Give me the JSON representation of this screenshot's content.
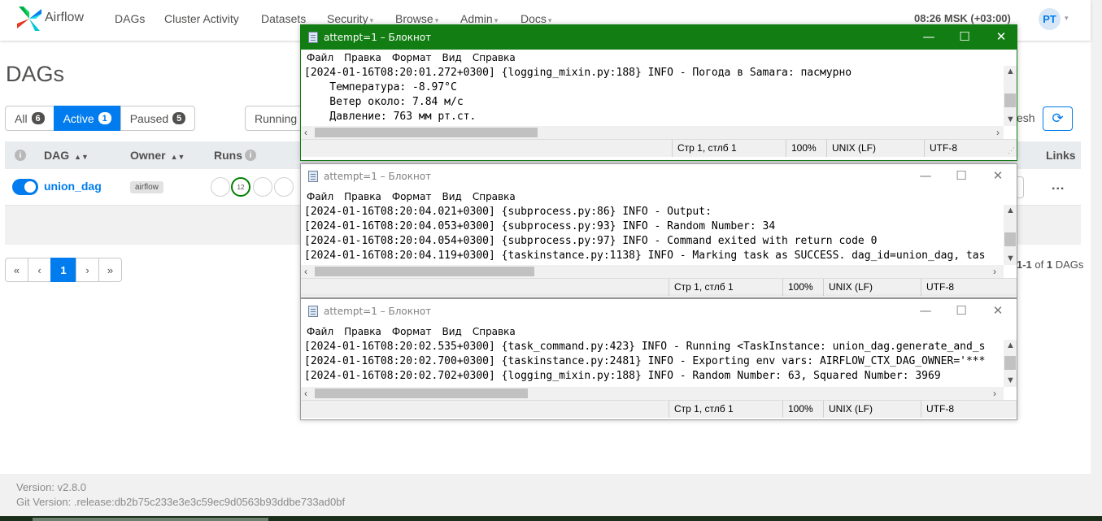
{
  "navbar": {
    "brand": "Airflow",
    "items": [
      {
        "label": "DAGs",
        "dropdown": false
      },
      {
        "label": "Cluster Activity",
        "dropdown": false
      },
      {
        "label": "Datasets",
        "dropdown": false
      },
      {
        "label": "Security",
        "dropdown": true
      },
      {
        "label": "Browse",
        "dropdown": true
      },
      {
        "label": "Admin",
        "dropdown": true
      },
      {
        "label": "Docs",
        "dropdown": true
      }
    ],
    "clock": "08:26 MSK (+03:00)",
    "user_initials": "PT",
    "colors": {
      "accent": "#017cee"
    }
  },
  "page": {
    "title": "DAGs",
    "filters": [
      {
        "label": "All",
        "count": "6",
        "active": false
      },
      {
        "label": "Active",
        "count": "1",
        "active": true
      },
      {
        "label": "Paused",
        "count": "5",
        "active": false
      }
    ],
    "running_label": "Running",
    "refresh_label": "esh",
    "refresh_icon": "refresh-icon",
    "table": {
      "headers": {
        "info": "i",
        "dag": "DAG",
        "owner": "Owner",
        "runs": "Runs",
        "links": "Links"
      },
      "rows": [
        {
          "enabled": true,
          "dag_id": "union_dag",
          "owner": "airflow",
          "runs_success": "12",
          "links": "..."
        }
      ]
    },
    "pagination": [
      "«",
      "‹",
      "1",
      "›",
      "»"
    ],
    "showing": {
      "range": "1-1",
      "of": "of",
      "total": "1",
      "suffix": "DAGs"
    }
  },
  "footer": {
    "version_label": "Version:",
    "version": "v2.8.0",
    "git_label": "Git Version:",
    "git_version": ".release:db2b75c233e3e3c59ec9d0563b93ddbe733ad0bf"
  },
  "notepad": {
    "menu": [
      "Файл",
      "Правка",
      "Формат",
      "Вид",
      "Справка"
    ],
    "controls": {
      "minimize": "—",
      "maximize": "☐",
      "close": "✕"
    },
    "windows": [
      {
        "title": "attempt=1 – Блокнот",
        "active": true,
        "lines": [
          "[2024-01-16T08:20:01.272+0300] {logging_mixin.py:188} INFO - Погода в Samara: пасмурно",
          "    Температура: -8.97°C",
          "    Ветер около: 7.84 м/с",
          "    Давление: 763 мм рт.ст."
        ],
        "status": {
          "position": "Стр 1, стлб 1",
          "zoom": "100%",
          "eol": "UNIX (LF)",
          "encoding": "UTF-8"
        }
      },
      {
        "title": "attempt=1 – Блокнот",
        "active": false,
        "lines": [
          "[2024-01-16T08:20:04.021+0300] {subprocess.py:86} INFO - Output:",
          "[2024-01-16T08:20:04.053+0300] {subprocess.py:93} INFO - Random Number: 34",
          "[2024-01-16T08:20:04.054+0300] {subprocess.py:97} INFO - Command exited with return code 0",
          "[2024-01-16T08:20:04.119+0300] {taskinstance.py:1138} INFO - Marking task as SUCCESS. dag_id=union_dag, tas"
        ],
        "status": {
          "position": "Стр 1, стлб 1",
          "zoom": "100%",
          "eol": "UNIX (LF)",
          "encoding": "UTF-8"
        }
      },
      {
        "title": "attempt=1 – Блокнот",
        "active": false,
        "lines": [
          "[2024-01-16T08:20:02.535+0300] {task_command.py:423} INFO - Running <TaskInstance: union_dag.generate_and_s",
          "[2024-01-16T08:20:02.700+0300] {taskinstance.py:2481} INFO - Exporting env vars: AIRFLOW_CTX_DAG_OWNER='***",
          "[2024-01-16T08:20:02.702+0300] {logging_mixin.py:188} INFO - Random Number: 63, Squared Number: 3969"
        ],
        "status": {
          "position": "Стр 1, стлб 1",
          "zoom": "100%",
          "eol": "UNIX (LF)",
          "encoding": "UTF-8"
        }
      }
    ]
  }
}
